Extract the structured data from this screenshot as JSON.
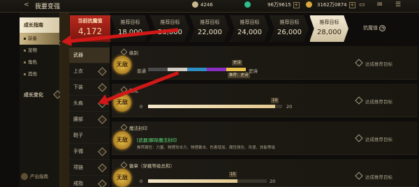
{
  "app": {
    "title": "我要变强",
    "back": "<"
  },
  "resources": [
    {
      "value": "4246",
      "icon": "coin-icon",
      "color": "#c9b88f"
    },
    {
      "value": "96万9615",
      "icon": "gem-icon",
      "color": "#2fbf8e"
    },
    {
      "value": "3162万0874",
      "icon": "gold-icon",
      "color": "#d8a83c"
    }
  ],
  "top_icons": [
    "✉",
    "☰"
  ],
  "left_nav": {
    "head": "成长指南",
    "items": [
      "装备",
      "宠物",
      "角色",
      "其他"
    ],
    "active_index": 0,
    "group2": "成长变化",
    "footer": "产出指南"
  },
  "categories": {
    "items": [
      "武器",
      "上衣",
      "下装",
      "头肩",
      "腰部",
      "鞋子",
      "手镯",
      "项链",
      "戒指"
    ],
    "active_index": 0
  },
  "header": {
    "current_label": "当前抗魔值",
    "current_value": "4,172",
    "target_label": "推荐目标",
    "targets": [
      "18,000",
      "20,000",
      "22,000",
      "24,000",
      "26,000",
      "28,000"
    ],
    "selected_index": 5,
    "kmz_label": "抗魔值"
  },
  "rows": [
    {
      "section": "级别",
      "badge": "无敌",
      "left": "普通",
      "right": "史诗",
      "tag_top": "史诗",
      "tag_bottom": "推荐：史诗",
      "goal": "达成推荐目标",
      "tier_colors": [
        "#4a4a4a",
        "#d1cdc3",
        "#2f8ec2",
        "#8b2fc2",
        "#e8c04a"
      ]
    },
    {
      "section": "强化",
      "badge": "无敌",
      "min": "0",
      "max": "20",
      "value": "19",
      "fill": 0.95,
      "goal": "达成推荐目标"
    },
    {
      "section": "魔法封印",
      "badge": "无敌",
      "line1": "[武器]解除魔法封印",
      "line2": "推荐属性：力量、物理攻击力、物理暴击、伤害增加、属性强化、攻速、技能等级",
      "goal": "达成推荐目标"
    },
    {
      "section": "徽章（穿戴等级总和）",
      "badge": "无敌",
      "min": "0",
      "max": "20",
      "value": "15",
      "fill": 0.75,
      "goal": "达成推荐目标"
    }
  ]
}
